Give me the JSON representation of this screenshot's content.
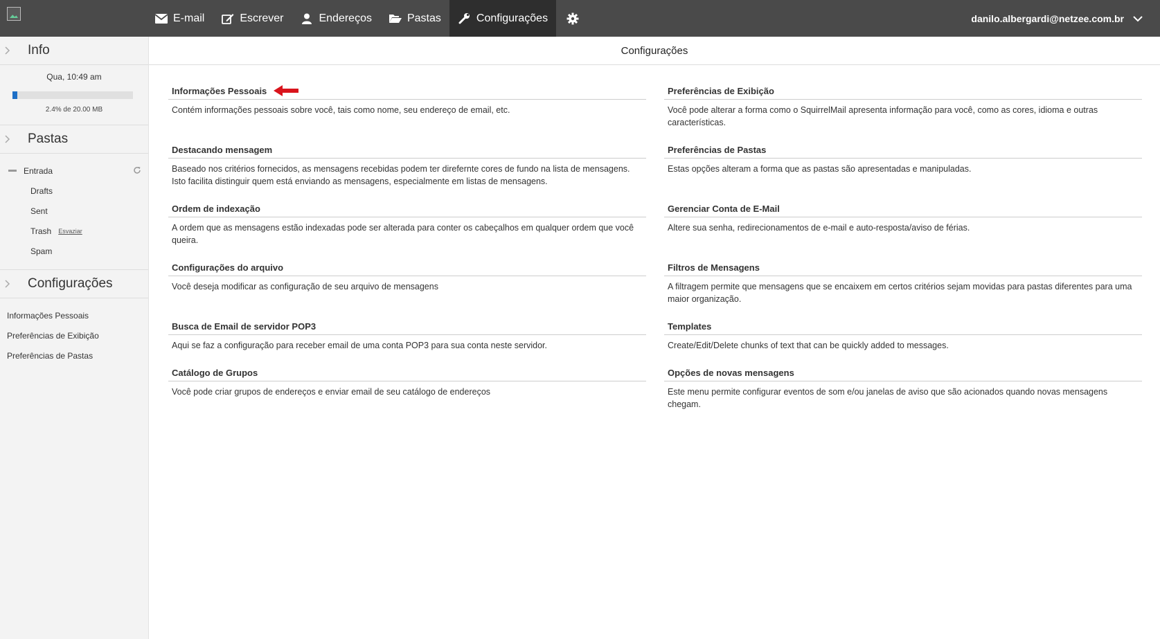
{
  "header": {
    "nav": [
      {
        "label": "E-mail",
        "icon": "envelope-icon"
      },
      {
        "label": "Escrever",
        "icon": "edit-icon"
      },
      {
        "label": "Endereços",
        "icon": "user-icon"
      },
      {
        "label": "Pastas",
        "icon": "folder-open-icon"
      },
      {
        "label": "Configurações",
        "icon": "wrench-icon",
        "active": true
      }
    ],
    "gear_icon": "gear-icon",
    "user_email": "danilo.albergardi@netzee.com.br",
    "accent": "#1e6fc6",
    "bar_color": "#4a4a4a"
  },
  "sidebar": {
    "info": {
      "title": "Info",
      "datetime": "Qua, 10:49 am",
      "quota_percent": 2.4,
      "quota_text": "2.4% de 20.00 MB"
    },
    "folders": {
      "title": "Pastas",
      "root": "Entrada",
      "items": [
        {
          "label": "Drafts"
        },
        {
          "label": "Sent"
        },
        {
          "label": "Trash",
          "action": "Esvaziar"
        },
        {
          "label": "Spam"
        }
      ]
    },
    "config": {
      "title": "Configurações",
      "links": [
        "Informações Pessoais",
        "Preferências de Exibição",
        "Preferências de Pastas"
      ]
    }
  },
  "main": {
    "title": "Configurações",
    "options_left": [
      {
        "title": "Informações Pessoais",
        "desc": "Contém informações pessoais sobre você, tais como nome, seu endereço de email, etc."
      },
      {
        "title": "Destacando mensagem",
        "desc": "Baseado nos critérios fornecidos, as mensagens recebidas podem ter direfernte cores de fundo na lista de mensagens. Isto facilita distinguir quem está enviando as mensagens, especialmente em listas de mensagens."
      },
      {
        "title": "Ordem de indexação",
        "desc": "A ordem que as mensagens estão indexadas pode ser alterada para conter os cabeçalhos em qualquer ordem que você queira."
      },
      {
        "title": "Configurações do arquivo",
        "desc": "Você deseja modificar as configuração de seu arquivo de mensagens"
      },
      {
        "title": "Busca de Email de servidor POP3",
        "desc": "Aqui se faz a configuração para receber email de uma conta POP3 para sua conta neste servidor."
      },
      {
        "title": "Catálogo de Grupos",
        "desc": "Você pode criar grupos de endereços e enviar email de seu catálogo de endereços"
      }
    ],
    "options_right": [
      {
        "title": "Preferências de Exibição",
        "desc": "Você pode alterar a forma como o SquirrelMail apresenta informação para você, como as cores, idioma e outras características."
      },
      {
        "title": "Preferências de Pastas",
        "desc": "Estas opções alteram a forma que as pastas são apresentadas e manipuladas."
      },
      {
        "title": "Gerenciar Conta de E-Mail",
        "desc": "Altere sua senha, redirecionamentos de e-mail e auto-resposta/aviso de férias."
      },
      {
        "title": "Filtros de Mensagens",
        "desc": "A filtragem permite que mensagens que se encaixem em certos critérios sejam movidas para pastas diferentes para uma maior organização."
      },
      {
        "title": "Templates",
        "desc": "Create/Edit/Delete chunks of text that can be quickly added to messages."
      },
      {
        "title": "Opções de novas mensagens",
        "desc": "Este menu permite configurar eventos de som e/ou janelas de aviso que são acionados quando novas mensagens chegam."
      }
    ],
    "arrow_color": "#d9141c"
  }
}
